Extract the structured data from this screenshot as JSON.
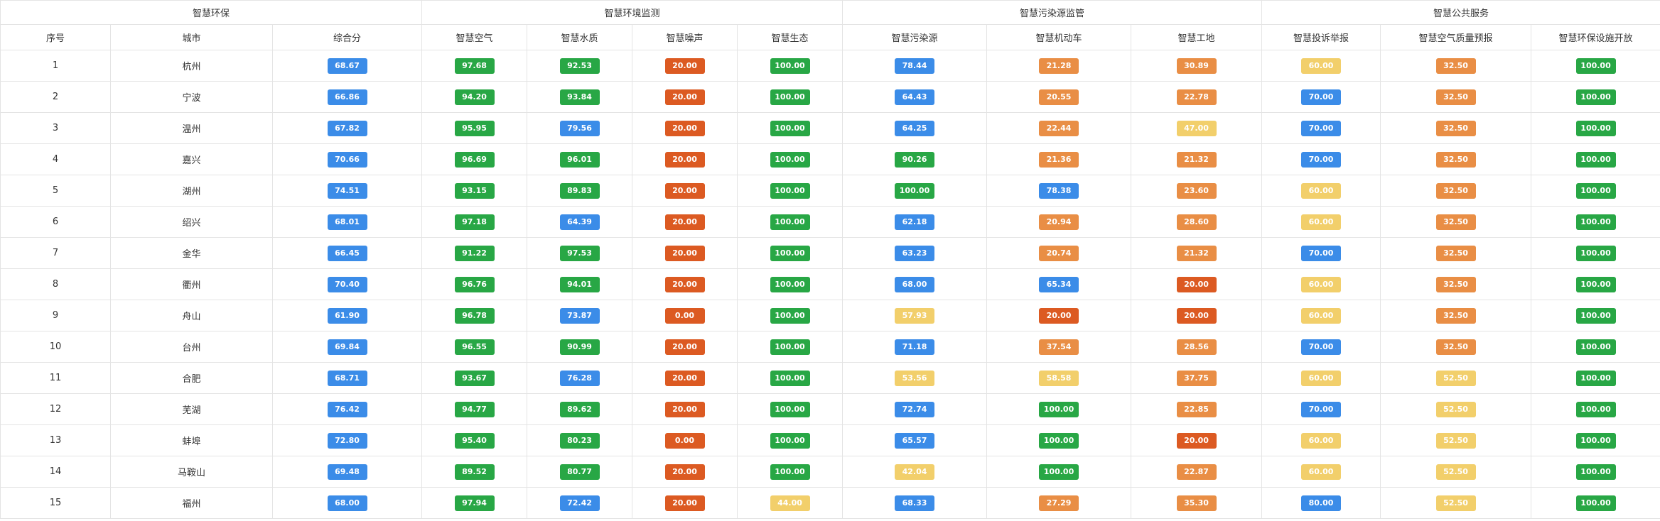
{
  "groups": [
    {
      "label": "智慧环保",
      "span": 3
    },
    {
      "label": "智慧环境监测",
      "span": 4
    },
    {
      "label": "智慧污染源监管",
      "span": 3
    },
    {
      "label": "智慧公共服务",
      "span": 3
    }
  ],
  "columns": [
    "序号",
    "城市",
    "综合分",
    "智慧空气",
    "智慧水质",
    "智慧噪声",
    "智慧生态",
    "智慧污染源",
    "智慧机动车",
    "智慧工地",
    "智慧投诉举报",
    "智慧空气质量预报",
    "智慧环保设施开放"
  ],
  "colors": {
    "green": "#28a745",
    "blue": "#3b8ce8",
    "red": "#dc5a22",
    "orange": "#e98e45",
    "yellow": "#f2cf6b"
  },
  "rows": [
    {
      "index": "1",
      "city": "杭州",
      "cells": [
        [
          "68.67",
          "blue"
        ],
        [
          "97.68",
          "green"
        ],
        [
          "92.53",
          "green"
        ],
        [
          "20.00",
          "red"
        ],
        [
          "100.00",
          "green"
        ],
        [
          "78.44",
          "blue"
        ],
        [
          "21.28",
          "orange"
        ],
        [
          "30.89",
          "orange"
        ],
        [
          "60.00",
          "yellow"
        ],
        [
          "32.50",
          "orange"
        ],
        [
          "100.00",
          "green"
        ]
      ]
    },
    {
      "index": "2",
      "city": "宁波",
      "cells": [
        [
          "66.86",
          "blue"
        ],
        [
          "94.20",
          "green"
        ],
        [
          "93.84",
          "green"
        ],
        [
          "20.00",
          "red"
        ],
        [
          "100.00",
          "green"
        ],
        [
          "64.43",
          "blue"
        ],
        [
          "20.55",
          "orange"
        ],
        [
          "22.78",
          "orange"
        ],
        [
          "70.00",
          "blue"
        ],
        [
          "32.50",
          "orange"
        ],
        [
          "100.00",
          "green"
        ]
      ]
    },
    {
      "index": "3",
      "city": "温州",
      "cells": [
        [
          "67.82",
          "blue"
        ],
        [
          "95.95",
          "green"
        ],
        [
          "79.56",
          "blue"
        ],
        [
          "20.00",
          "red"
        ],
        [
          "100.00",
          "green"
        ],
        [
          "64.25",
          "blue"
        ],
        [
          "22.44",
          "orange"
        ],
        [
          "47.00",
          "yellow"
        ],
        [
          "70.00",
          "blue"
        ],
        [
          "32.50",
          "orange"
        ],
        [
          "100.00",
          "green"
        ]
      ]
    },
    {
      "index": "4",
      "city": "嘉兴",
      "cells": [
        [
          "70.66",
          "blue"
        ],
        [
          "96.69",
          "green"
        ],
        [
          "96.01",
          "green"
        ],
        [
          "20.00",
          "red"
        ],
        [
          "100.00",
          "green"
        ],
        [
          "90.26",
          "green"
        ],
        [
          "21.36",
          "orange"
        ],
        [
          "21.32",
          "orange"
        ],
        [
          "70.00",
          "blue"
        ],
        [
          "32.50",
          "orange"
        ],
        [
          "100.00",
          "green"
        ]
      ]
    },
    {
      "index": "5",
      "city": "湖州",
      "cells": [
        [
          "74.51",
          "blue"
        ],
        [
          "93.15",
          "green"
        ],
        [
          "89.83",
          "green"
        ],
        [
          "20.00",
          "red"
        ],
        [
          "100.00",
          "green"
        ],
        [
          "100.00",
          "green"
        ],
        [
          "78.38",
          "blue"
        ],
        [
          "23.60",
          "orange"
        ],
        [
          "60.00",
          "yellow"
        ],
        [
          "32.50",
          "orange"
        ],
        [
          "100.00",
          "green"
        ]
      ]
    },
    {
      "index": "6",
      "city": "绍兴",
      "cells": [
        [
          "68.01",
          "blue"
        ],
        [
          "97.18",
          "green"
        ],
        [
          "64.39",
          "blue"
        ],
        [
          "20.00",
          "red"
        ],
        [
          "100.00",
          "green"
        ],
        [
          "62.18",
          "blue"
        ],
        [
          "20.94",
          "orange"
        ],
        [
          "28.60",
          "orange"
        ],
        [
          "60.00",
          "yellow"
        ],
        [
          "32.50",
          "orange"
        ],
        [
          "100.00",
          "green"
        ]
      ]
    },
    {
      "index": "7",
      "city": "金华",
      "cells": [
        [
          "66.45",
          "blue"
        ],
        [
          "91.22",
          "green"
        ],
        [
          "97.53",
          "green"
        ],
        [
          "20.00",
          "red"
        ],
        [
          "100.00",
          "green"
        ],
        [
          "63.23",
          "blue"
        ],
        [
          "20.74",
          "orange"
        ],
        [
          "21.32",
          "orange"
        ],
        [
          "70.00",
          "blue"
        ],
        [
          "32.50",
          "orange"
        ],
        [
          "100.00",
          "green"
        ]
      ]
    },
    {
      "index": "8",
      "city": "衢州",
      "cells": [
        [
          "70.40",
          "blue"
        ],
        [
          "96.76",
          "green"
        ],
        [
          "94.01",
          "green"
        ],
        [
          "20.00",
          "red"
        ],
        [
          "100.00",
          "green"
        ],
        [
          "68.00",
          "blue"
        ],
        [
          "65.34",
          "blue"
        ],
        [
          "20.00",
          "red"
        ],
        [
          "60.00",
          "yellow"
        ],
        [
          "32.50",
          "orange"
        ],
        [
          "100.00",
          "green"
        ]
      ]
    },
    {
      "index": "9",
      "city": "舟山",
      "cells": [
        [
          "61.90",
          "blue"
        ],
        [
          "96.78",
          "green"
        ],
        [
          "73.87",
          "blue"
        ],
        [
          "0.00",
          "red"
        ],
        [
          "100.00",
          "green"
        ],
        [
          "57.93",
          "yellow"
        ],
        [
          "20.00",
          "red"
        ],
        [
          "20.00",
          "red"
        ],
        [
          "60.00",
          "yellow"
        ],
        [
          "32.50",
          "orange"
        ],
        [
          "100.00",
          "green"
        ]
      ]
    },
    {
      "index": "10",
      "city": "台州",
      "cells": [
        [
          "69.84",
          "blue"
        ],
        [
          "96.55",
          "green"
        ],
        [
          "90.99",
          "green"
        ],
        [
          "20.00",
          "red"
        ],
        [
          "100.00",
          "green"
        ],
        [
          "71.18",
          "blue"
        ],
        [
          "37.54",
          "orange"
        ],
        [
          "28.56",
          "orange"
        ],
        [
          "70.00",
          "blue"
        ],
        [
          "32.50",
          "orange"
        ],
        [
          "100.00",
          "green"
        ]
      ]
    },
    {
      "index": "11",
      "city": "合肥",
      "cells": [
        [
          "68.71",
          "blue"
        ],
        [
          "93.67",
          "green"
        ],
        [
          "76.28",
          "blue"
        ],
        [
          "20.00",
          "red"
        ],
        [
          "100.00",
          "green"
        ],
        [
          "53.56",
          "yellow"
        ],
        [
          "58.58",
          "yellow"
        ],
        [
          "37.75",
          "orange"
        ],
        [
          "60.00",
          "yellow"
        ],
        [
          "52.50",
          "yellow"
        ],
        [
          "100.00",
          "green"
        ]
      ]
    },
    {
      "index": "12",
      "city": "芜湖",
      "cells": [
        [
          "76.42",
          "blue"
        ],
        [
          "94.77",
          "green"
        ],
        [
          "89.62",
          "green"
        ],
        [
          "20.00",
          "red"
        ],
        [
          "100.00",
          "green"
        ],
        [
          "72.74",
          "blue"
        ],
        [
          "100.00",
          "green"
        ],
        [
          "22.85",
          "orange"
        ],
        [
          "70.00",
          "blue"
        ],
        [
          "52.50",
          "yellow"
        ],
        [
          "100.00",
          "green"
        ]
      ]
    },
    {
      "index": "13",
      "city": "蚌埠",
      "cells": [
        [
          "72.80",
          "blue"
        ],
        [
          "95.40",
          "green"
        ],
        [
          "80.23",
          "green"
        ],
        [
          "0.00",
          "red"
        ],
        [
          "100.00",
          "green"
        ],
        [
          "65.57",
          "blue"
        ],
        [
          "100.00",
          "green"
        ],
        [
          "20.00",
          "red"
        ],
        [
          "60.00",
          "yellow"
        ],
        [
          "52.50",
          "yellow"
        ],
        [
          "100.00",
          "green"
        ]
      ]
    },
    {
      "index": "14",
      "city": "马鞍山",
      "cells": [
        [
          "69.48",
          "blue"
        ],
        [
          "89.52",
          "green"
        ],
        [
          "80.77",
          "green"
        ],
        [
          "20.00",
          "red"
        ],
        [
          "100.00",
          "green"
        ],
        [
          "42.04",
          "yellow"
        ],
        [
          "100.00",
          "green"
        ],
        [
          "22.87",
          "orange"
        ],
        [
          "60.00",
          "yellow"
        ],
        [
          "52.50",
          "yellow"
        ],
        [
          "100.00",
          "green"
        ]
      ]
    },
    {
      "index": "15",
      "city": "福州",
      "cells": [
        [
          "68.00",
          "blue"
        ],
        [
          "97.94",
          "green"
        ],
        [
          "72.42",
          "blue"
        ],
        [
          "20.00",
          "red"
        ],
        [
          "44.00",
          "yellow"
        ],
        [
          "68.33",
          "blue"
        ],
        [
          "27.29",
          "orange"
        ],
        [
          "35.30",
          "orange"
        ],
        [
          "80.00",
          "blue"
        ],
        [
          "52.50",
          "yellow"
        ],
        [
          "100.00",
          "green"
        ]
      ]
    }
  ]
}
